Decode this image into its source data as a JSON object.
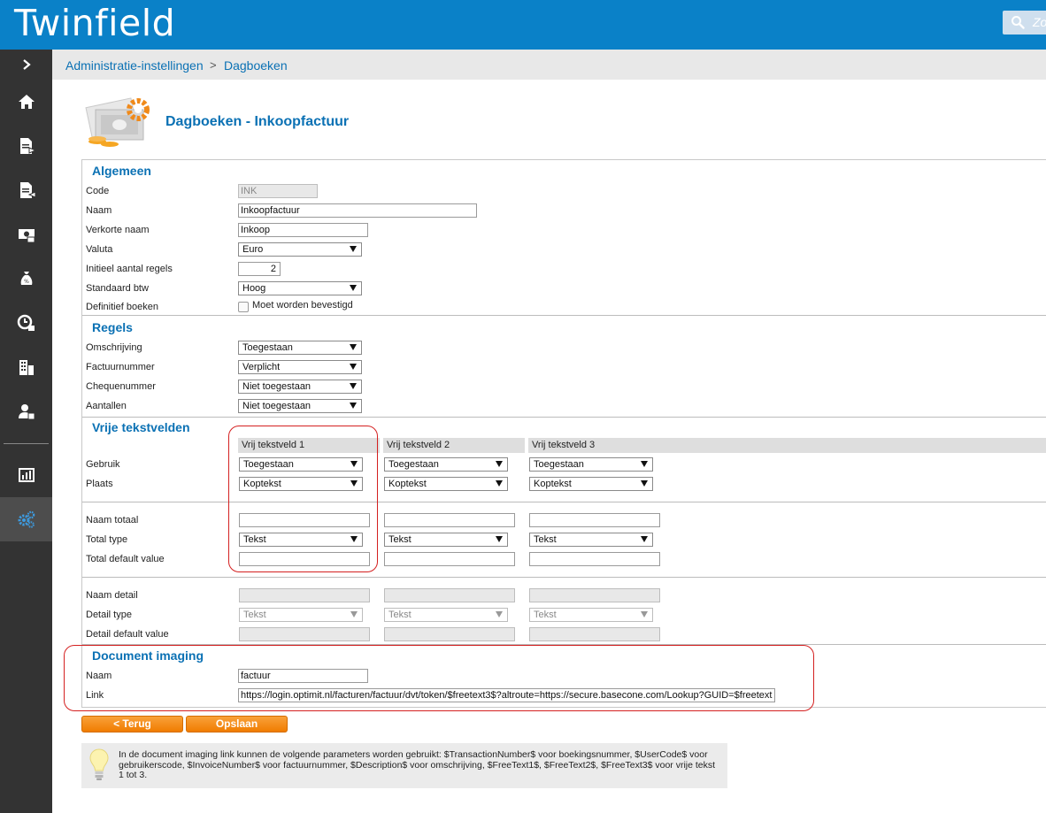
{
  "app": {
    "logo": "Twinfield",
    "search_text": "Zo"
  },
  "breadcrumb": {
    "first": "Administratie-instellingen",
    "separator": ">",
    "second": "Dagboeken"
  },
  "page_title": "Dagboeken - Inkoopfactuur",
  "sections": {
    "algemeen": {
      "title": "Algemeen",
      "code_label": "Code",
      "code_value": "INK",
      "naam_label": "Naam",
      "naam_value": "Inkoopfactuur",
      "verkorte_label": "Verkorte naam",
      "verkorte_value": "Inkoop",
      "valuta_label": "Valuta",
      "valuta_value": "Euro",
      "regels_label": "Initieel aantal regels",
      "regels_value": "2",
      "btw_label": "Standaard btw",
      "btw_value": "Hoog",
      "definitief_label": "Definitief boeken",
      "definitief_check_label": "Moet worden bevestigd"
    },
    "regels": {
      "title": "Regels",
      "omschrijving_label": "Omschrijving",
      "omschrijving_value": "Toegestaan",
      "factuurnummer_label": "Factuurnummer",
      "factuurnummer_value": "Verplicht",
      "chequenummer_label": "Chequenummer",
      "chequenummer_value": "Niet toegestaan",
      "aantallen_label": "Aantallen",
      "aantallen_value": "Niet toegestaan"
    },
    "vrije": {
      "title": "Vrije tekstvelden",
      "columns": [
        "Vrij tekstveld 1",
        "Vrij tekstveld 2",
        "Vrij tekstveld 3"
      ],
      "gebruik_label": "Gebruik",
      "gebruik_values": [
        "Toegestaan",
        "Toegestaan",
        "Toegestaan"
      ],
      "plaats_label": "Plaats",
      "plaats_values": [
        "Koptekst",
        "Koptekst",
        "Koptekst"
      ],
      "naam_totaal_label": "Naam totaal",
      "total_type_label": "Total type",
      "total_type_values": [
        "Tekst",
        "Tekst",
        "Tekst"
      ],
      "total_default_label": "Total default value",
      "naam_detail_label": "Naam detail",
      "detail_type_label": "Detail type",
      "detail_type_values": [
        "Tekst",
        "Tekst",
        "Tekst"
      ],
      "detail_default_label": "Detail default value"
    },
    "imaging": {
      "title": "Document imaging",
      "naam_label": "Naam",
      "naam_value": "factuur",
      "link_label": "Link",
      "link_value": "https://login.optimit.nl/facturen/factuur/dvt/token/$freetext3$?altroute=https://secure.basecone.com/Lookup?GUID=$freetext"
    }
  },
  "buttons": {
    "back": "< Terug",
    "save": "Opslaan"
  },
  "info_text": "In de document imaging link kunnen de volgende parameters worden gebruikt: $TransactionNumber$ voor boekingsnummer, $UserCode$ voor gebruikerscode, $InvoiceNumber$ voor factuurnummer, $Description$ voor omschrijving, $FreeText1$, $FreeText2$, $FreeText3$ voor vrije tekst 1 tot 3.",
  "colors": {
    "brand": "#0a81c8",
    "sidebar": "#333333",
    "accent_button": "#f08a1a",
    "highlight": "#d42020"
  }
}
